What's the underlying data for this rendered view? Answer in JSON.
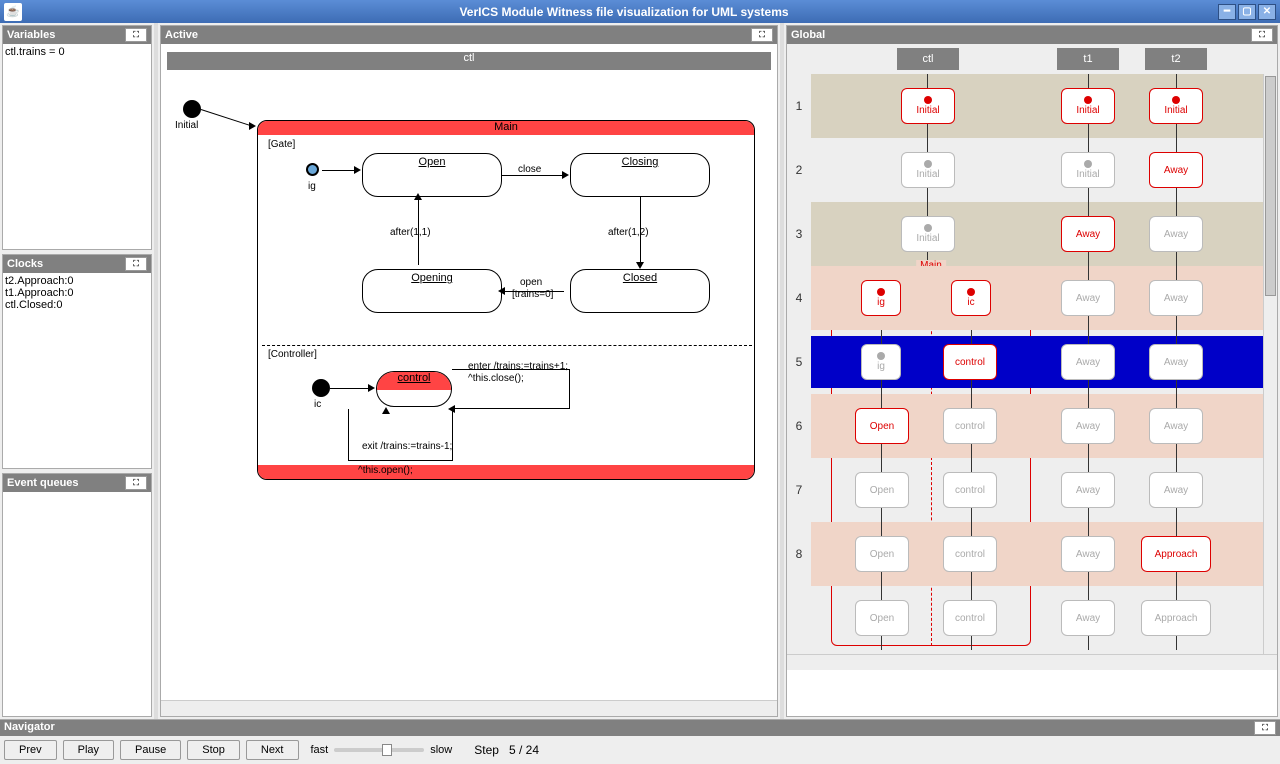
{
  "window": {
    "title": "VerICS Module Witness file visualization for UML systems"
  },
  "panels": {
    "variables": "Variables",
    "clocks": "Clocks",
    "eventq": "Event queues",
    "active": "Active",
    "global": "Global",
    "navigator": "Navigator"
  },
  "variables": [
    "ctl.trains = 0"
  ],
  "clocks": [
    "t2.Approach:0",
    "t1.Approach:0",
    "ctl.Closed:0"
  ],
  "active": {
    "ctl": "ctl",
    "initial": "Initial",
    "main": "Main",
    "gate": "[Gate]",
    "controller": "[Controller]",
    "ig": "ig",
    "ic": "ic",
    "open": "Open",
    "closing": "Closing",
    "closed": "Closed",
    "opening": "Opening",
    "control": "control",
    "close": "close",
    "after11": "after(1,1)",
    "after12": "after(1,2)",
    "open_guard1": "open",
    "open_guard2": "[trains=0]",
    "enter": "enter /trains:=trains+1;",
    "thisclose": "^this.close();",
    "exit": "exit /trains:=trains-1;",
    "thisopen": "^this.open();"
  },
  "global": {
    "cols": [
      "ctl",
      "t1",
      "t2"
    ],
    "rows": [
      "1",
      "2",
      "3",
      "4",
      "5",
      "6",
      "7",
      "8"
    ],
    "main": "Main",
    "cells": {
      "r1": {
        "ctl": [
          "Initial",
          "a"
        ],
        "t1": [
          "Initial",
          "a"
        ],
        "t2": [
          "Initial",
          "a"
        ]
      },
      "r2": {
        "ctl": [
          "Initial",
          "i"
        ],
        "t1": [
          "Initial",
          "i"
        ],
        "t2": [
          "Away",
          "a"
        ]
      },
      "r3": {
        "ctl": [
          "Initial",
          "i"
        ],
        "t1": [
          "Away",
          "a"
        ],
        "t2": [
          "Away",
          "i"
        ]
      },
      "r4": {
        "ctl_a": [
          "ig",
          "a"
        ],
        "ctl_b": [
          "ic",
          "a"
        ],
        "t1": [
          "Away",
          "i"
        ],
        "t2": [
          "Away",
          "i"
        ]
      },
      "r5": {
        "ctl_a": [
          "ig",
          "i"
        ],
        "ctl_b": [
          "control",
          "a"
        ],
        "t1": [
          "Away",
          "i"
        ],
        "t2": [
          "Away",
          "i"
        ]
      },
      "r6": {
        "ctl_a": [
          "Open",
          "a"
        ],
        "ctl_b": [
          "control",
          "i"
        ],
        "t1": [
          "Away",
          "i"
        ],
        "t2": [
          "Away",
          "i"
        ]
      },
      "r7": {
        "ctl_a": [
          "Open",
          "i"
        ],
        "ctl_b": [
          "control",
          "i"
        ],
        "t1": [
          "Away",
          "i"
        ],
        "t2": [
          "Away",
          "i"
        ]
      },
      "r8": {
        "ctl_a": [
          "Open",
          "i"
        ],
        "ctl_b": [
          "control",
          "i"
        ],
        "t1": [
          "Away",
          "i"
        ],
        "t2": [
          "Approach",
          "a"
        ]
      },
      "r9": {
        "ctl_a": [
          "Open",
          "i"
        ],
        "ctl_b": [
          "control",
          "i"
        ],
        "t1": [
          "Away",
          "i"
        ],
        "t2": [
          "Approach",
          "i"
        ]
      }
    }
  },
  "nav": {
    "prev": "Prev",
    "play": "Play",
    "pause": "Pause",
    "stop": "Stop",
    "next": "Next",
    "fast": "fast",
    "slow": "slow",
    "step_label": "Step",
    "step_cur": "5",
    "step_sep": "/",
    "step_total": "24"
  }
}
